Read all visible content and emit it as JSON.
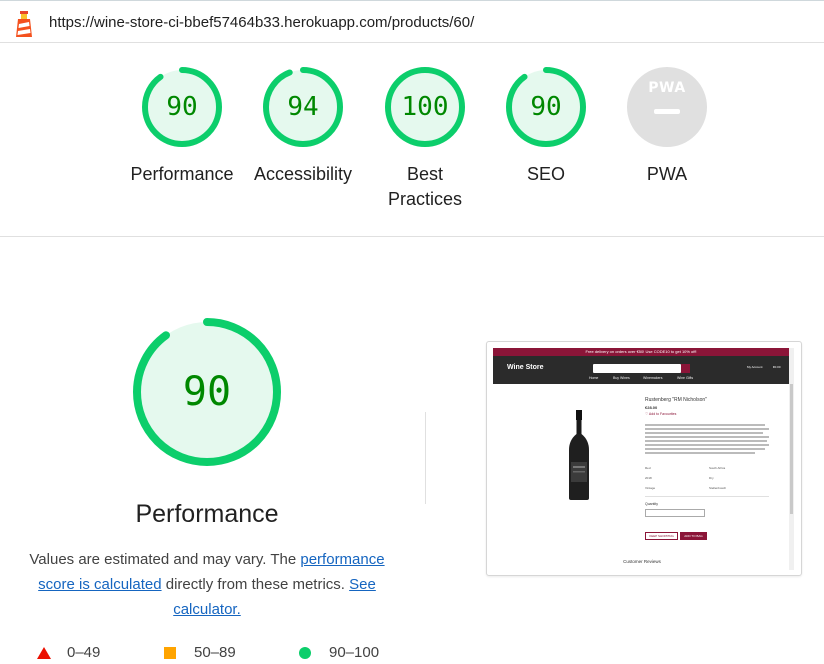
{
  "browser": {
    "url": "https://wine-store-ci-bbef57464b33.herokuapp.com/products/60/"
  },
  "colors": {
    "pass": "#0cce6b",
    "pass_text": "#008800",
    "pass_fill": "#e5f9ee",
    "average": "#ffa400",
    "fail": "#eb0f00",
    "na_gray": "#e0e0e0",
    "link": "#1565c0"
  },
  "gauges": [
    {
      "name": "performance",
      "score": "90",
      "label": "Performance",
      "fraction": 0.9
    },
    {
      "name": "accessibility",
      "score": "94",
      "label": "Accessibility",
      "fraction": 0.94
    },
    {
      "name": "best-practices",
      "score": "100",
      "label": "Best Practices",
      "fraction": 1.0
    },
    {
      "name": "seo",
      "score": "90",
      "label": "SEO",
      "fraction": 0.9
    },
    {
      "name": "pwa",
      "score": "",
      "label": "PWA",
      "badge_text": "PWA",
      "icon": "pwa-badge-icon"
    }
  ],
  "performance": {
    "score": "90",
    "fraction": 0.9,
    "title": "Performance",
    "desc_prefix": "Values are estimated and may vary. The ",
    "desc_link": "performance score is calculated",
    "desc_middle": " directly from these metrics. ",
    "desc_link2": "See calculator."
  },
  "legend": {
    "fail": "0–49",
    "average": "50–89",
    "pass": "90–100"
  },
  "thumbnail": {
    "banner": "Free delivery on orders over €50! Use CODE10 to get 10% off!",
    "brand": "Wine Store",
    "menu": [
      "Home",
      "Buy Wines",
      "Winemakers",
      "Wine Gifts"
    ],
    "account": "My Account",
    "bag": "€0.00",
    "product_title": "Rustenberg \"RM Nicholson\"",
    "price": "€28.00",
    "favourite": "♡ Add to Favourites",
    "attributes": [
      "Red",
      "South Africa",
      "2018",
      "Dry",
      "Vintage",
      "Stellenbosch"
    ],
    "quantity": "Quantity",
    "keep_shopping": "KEEP SHOPPING",
    "add_to_bag": "ADD TO BAG",
    "reviews": "Customer Reviews"
  }
}
